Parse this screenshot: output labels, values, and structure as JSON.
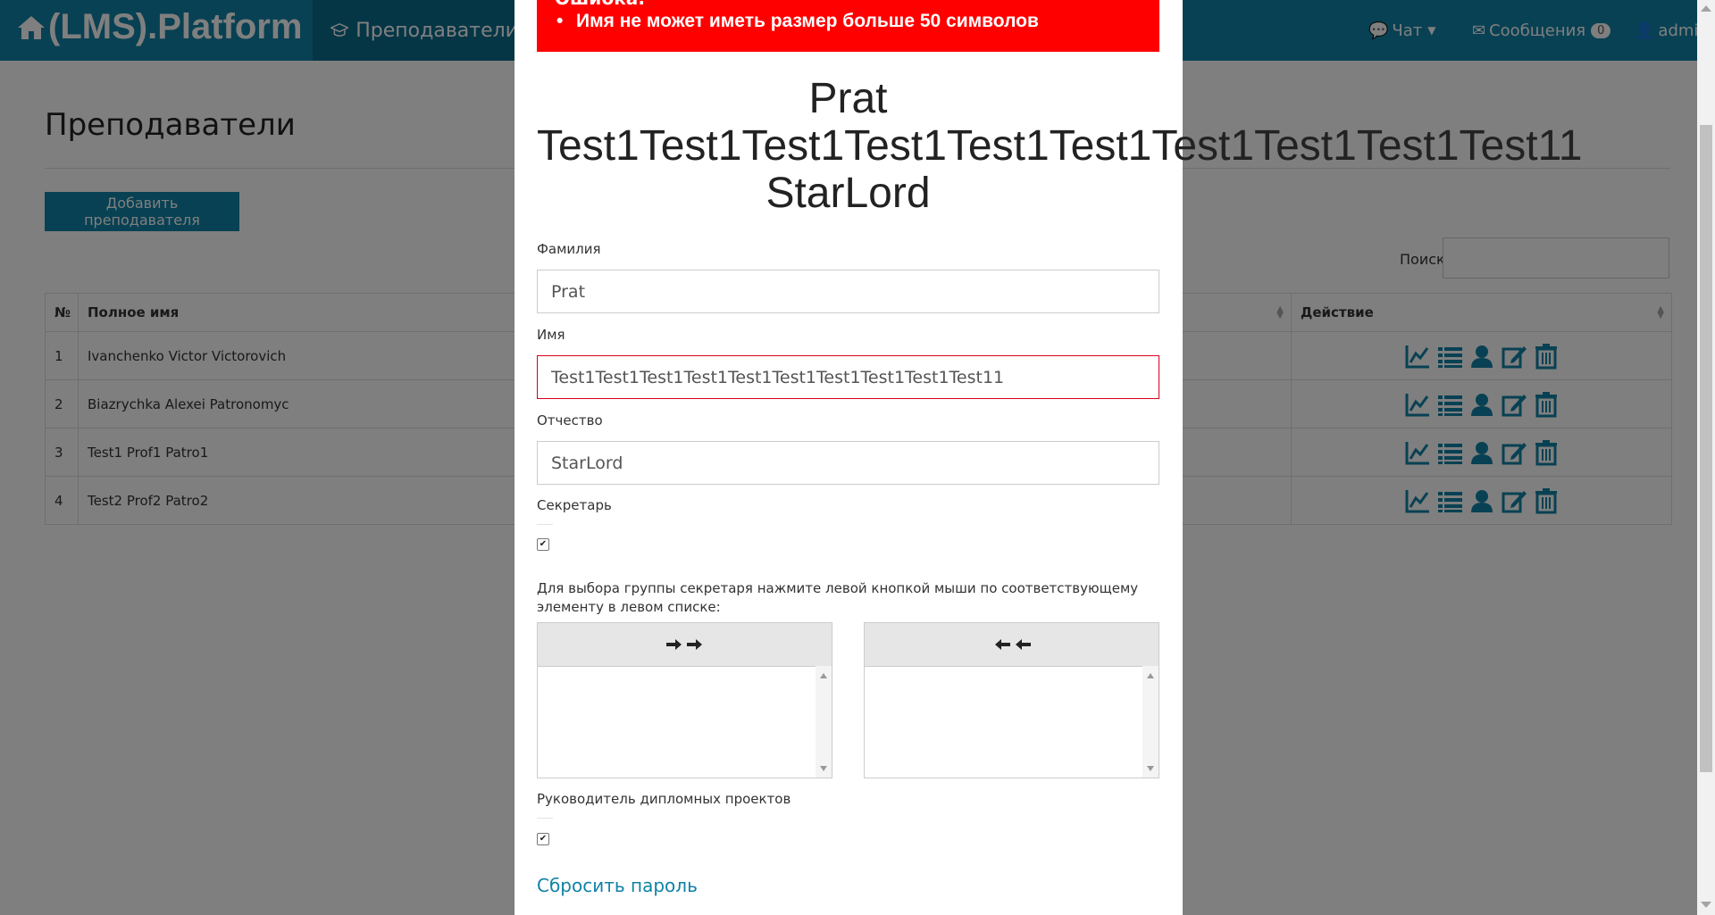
{
  "navbar": {
    "brand": "(LMS).Platform",
    "active_item": "Преподаватели",
    "chat": "Чат",
    "messages": "Сообщения",
    "messages_count": "0",
    "user": "admin",
    "color": "#1082a6"
  },
  "page": {
    "title": "Преподаватели",
    "add_button": "Добавить преподавателя",
    "search_label": "Поиск",
    "search_value": ""
  },
  "table": {
    "columns": [
      "№",
      "Полное имя",
      "Действие"
    ],
    "rows": [
      {
        "n": "1",
        "name": "Ivanchenko Victor Victorovich"
      },
      {
        "n": "2",
        "name": "Biazrychka Alexei Patronomyc"
      },
      {
        "n": "3",
        "name": "Test1 Prof1 Patro1"
      },
      {
        "n": "4",
        "name": "Test2 Prof2 Patro2"
      }
    ],
    "action_icons": [
      "chart-line-icon",
      "list-icon",
      "user-icon",
      "edit-icon",
      "trash-icon"
    ]
  },
  "modal": {
    "error_title": "Ошибка:",
    "error_item": "Имя не может иметь размер больше 50 символов",
    "heading_last": "Prat",
    "heading_first": "Test1Test1Test1Test1Test1Test1Test1Test1Test1Test11",
    "heading_middle": "StarLord",
    "last_name_label": "Фамилия",
    "last_name_value": "Prat",
    "first_name_label": "Имя",
    "first_name_value": "Test1Test1Test1Test1Test1Test1Test1Test1Test1Test11",
    "middle_name_label": "Отчество",
    "middle_name_value": "StarLord",
    "secretary_label": "Секретарь",
    "secretary_checked": true,
    "help_text": "Для выбора группы секретаря нажмите левой кнопкой мыши по соответствующему элементу в левом списке:",
    "supervisor_label": "Руководитель дипломных проектов",
    "supervisor_checked": true,
    "reset_password": "Сбросить пароль",
    "error_color": "#ff0000"
  }
}
